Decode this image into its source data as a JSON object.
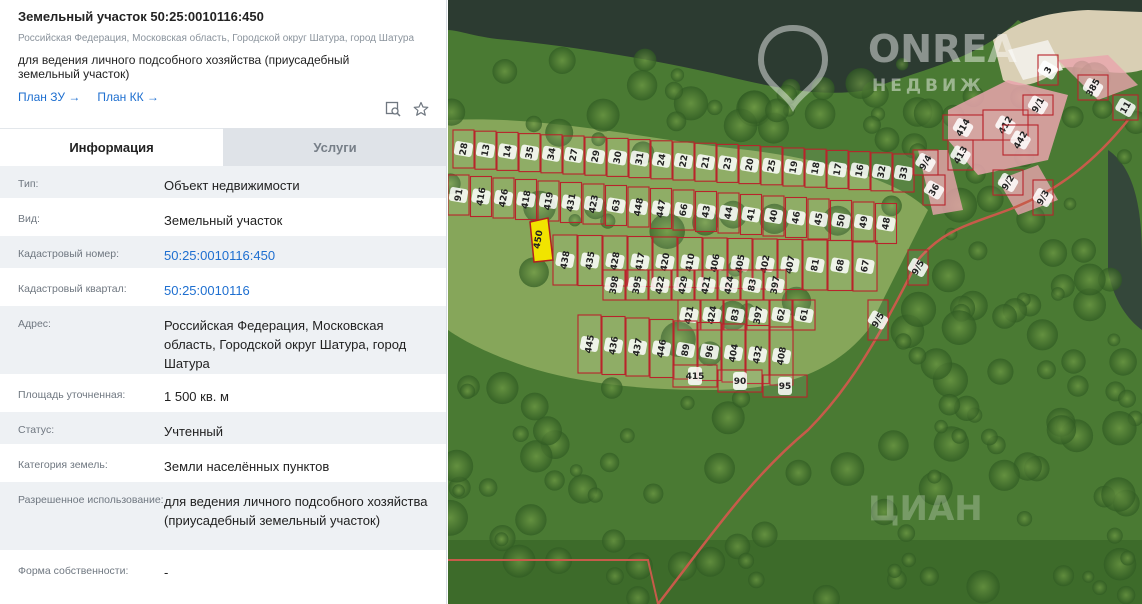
{
  "header": {
    "title": "Земельный участок 50:25:0010116:450",
    "address": "Российская Федерация, Московская область, Городской округ Шатура, город Шатура",
    "usage": "для ведения личного подсобного хозяйства (приусадебный земельный участок)",
    "links": [
      "План ЗУ →",
      "План КК →"
    ]
  },
  "tabs": [
    {
      "label": "Информация",
      "active": true
    },
    {
      "label": "Услуги",
      "active": false
    }
  ],
  "rows": [
    {
      "label": "Тип:",
      "value": "Объект недвижимости"
    },
    {
      "label": "Вид:",
      "value": "Земельный участок"
    },
    {
      "label": "Кадастровый номер:",
      "value": "50:25:0010116:450"
    },
    {
      "label": "Кадастровый квартал:",
      "value": "50:25:0010116"
    },
    {
      "label": "Адрес:",
      "value": "Российская Федерация, Московская область, Городской округ Шатура, город Шатура"
    },
    {
      "label": "Площадь уточненная:",
      "value": "1 500 кв. м"
    },
    {
      "label": "Статус:",
      "value": "Учтенный"
    },
    {
      "label": "Категория земель:",
      "value": "Земли населённых пунктов"
    },
    {
      "label": "Разрешенное использование:",
      "value": "для ведения личного подсобного хозяйства (приусадебный земельный участок)"
    },
    {
      "label": "Форма собственности:",
      "value": "-"
    }
  ],
  "map": {
    "watermark_1": "ONREA",
    "watermark_2": "НЕДВИЖ",
    "watermark_3": "ЦИАН",
    "selected_parcel": "450",
    "parcels_row1": [
      "28",
      "13",
      "14",
      "35",
      "34",
      "27",
      "29",
      "30",
      "31",
      "24",
      "22",
      "21",
      "23",
      "20",
      "25",
      "19",
      "18",
      "17",
      "16",
      "32",
      "33"
    ],
    "parcels_row2": [
      "91",
      "416",
      "426",
      "418",
      "419",
      "431",
      "423",
      "63",
      "448",
      "447",
      "66",
      "43",
      "44",
      "41",
      "40",
      "46",
      "45",
      "50",
      "49",
      "48"
    ],
    "parcels_row3": [
      "438",
      "435",
      "428",
      "417",
      "420",
      "410",
      "406",
      "405",
      "402",
      "407",
      "81",
      "68",
      "67"
    ],
    "parcels_row4": [
      "398",
      "395",
      "422",
      "429",
      "421",
      "424",
      "83",
      "397"
    ],
    "parcels_row5": [
      "421",
      "424",
      "83",
      "397",
      "62",
      "61"
    ],
    "parcels_row6": [
      "445",
      "436",
      "437",
      "446",
      "89",
      "96",
      "404",
      "432",
      "408"
    ],
    "parcels_row7": [
      "415",
      "90",
      "95"
    ],
    "parcels_right": [
      "414",
      "412",
      "413",
      "9/4",
      "36",
      "442",
      "9/2",
      "9/1",
      "3",
      "385",
      "11",
      "9/3",
      "9/5",
      "9/5"
    ]
  }
}
